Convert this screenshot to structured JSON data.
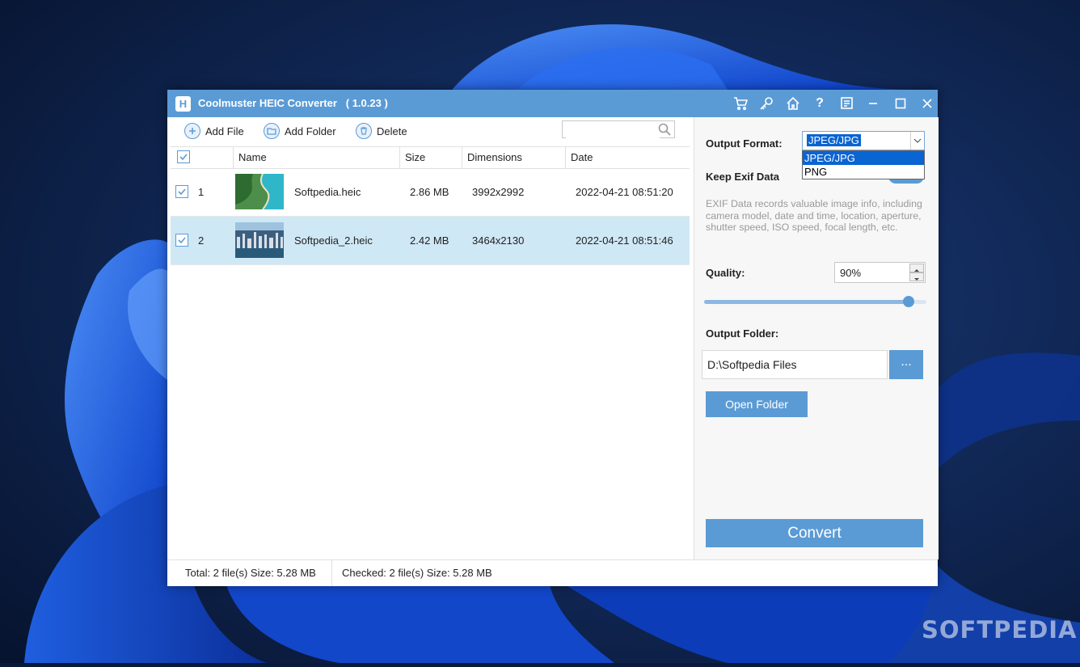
{
  "window": {
    "title": "Coolmuster HEIC Converter   ( 1.0.23 )",
    "accent_color": "#5b9bd5"
  },
  "title_icons": [
    "cart-icon",
    "key-icon",
    "home-icon",
    "help-icon",
    "feedback-icon",
    "minimize-icon",
    "maximize-icon",
    "close-icon"
  ],
  "toolbar": {
    "add_file": "Add File",
    "add_folder": "Add Folder",
    "delete": "Delete",
    "search_placeholder": ""
  },
  "table": {
    "headers": [
      "Name",
      "Size",
      "Dimensions",
      "Date"
    ],
    "rows": [
      {
        "index": "1",
        "name": "Softpedia.heic",
        "size": "2.86 MB",
        "dimensions": "3992x2992",
        "date": "2022-04-21 08:51:20",
        "checked": true
      },
      {
        "index": "2",
        "name": "Softpedia_2.heic",
        "size": "2.42 MB",
        "dimensions": "3464x2130",
        "date": "2022-04-21 08:51:46",
        "checked": true
      }
    ]
  },
  "status": {
    "total": "Total: 2 file(s) Size: 5.28 MB",
    "checked": "Checked: 2 file(s) Size: 5.28 MB"
  },
  "panel": {
    "output_format_label": "Output Format:",
    "output_format_value": "JPEG/JPG",
    "format_options": [
      "JPEG/JPG",
      "PNG"
    ],
    "keep_exif_label": "Keep Exif Data",
    "exif_description": "EXIF Data records valuable image info, including camera model, date and time, location, aperture, shutter speed, ISO speed, focal length, etc.",
    "quality_label": "Quality:",
    "quality_value": "90%",
    "quality_percent": 92,
    "output_folder_label": "Output Folder:",
    "output_folder_value": "D:\\Softpedia Files",
    "browse_label": "...",
    "open_folder_label": "Open Folder",
    "convert_label": "Convert"
  },
  "watermark": "SOFTPEDIA"
}
